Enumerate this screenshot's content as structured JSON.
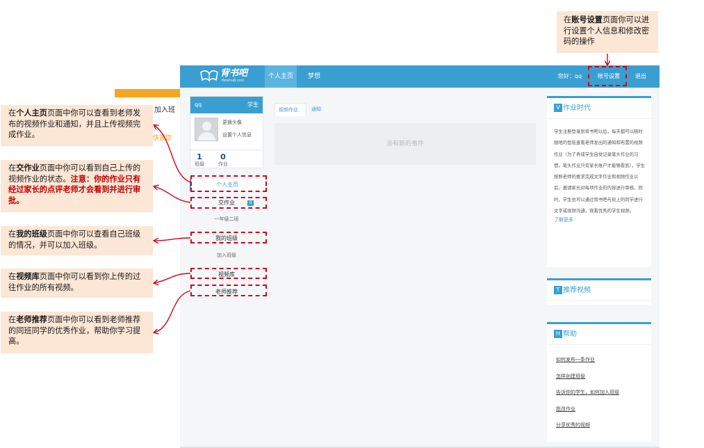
{
  "app": {
    "logo": {
      "name": "背书吧",
      "domain": "Beishu8.com"
    },
    "nav": {
      "home": "个人主页",
      "dream": "梦想",
      "hello": "您好：qq",
      "settings": "帐号设置",
      "logout": "退出"
    },
    "profile": {
      "username": "qq",
      "role": "学生",
      "change_avatar": "更换头像",
      "set_info": "设置个人信息",
      "stats": [
        {
          "num": "1",
          "label": "班级"
        },
        {
          "num": "0",
          "label": "作业"
        }
      ]
    },
    "menu": {
      "home": "个人主页",
      "homework": "交作业",
      "homework_badge": "0",
      "class_name": "一年级二班",
      "my_class": "我的班级",
      "join_class": "加入班级",
      "video_lib": "视频库",
      "teacher_rec": "老师推荐"
    },
    "tabs": [
      "视频作业",
      "通知"
    ],
    "events_empty": "没有新的事件",
    "panels": {
      "era": {
        "badge": "V",
        "title": "作业时代",
        "text": "学生注册登录到背书吧以后，每天都可以随时随地的登陆查看老师发出的通知和布置的视频作业（为了养成学生自觉记录笔头作业的习惯，笔头作业只有家长账户才能够看到），学生按照老师的要求完成文字作业和视频作业以后，邀请家长对每项作业的内容进行审核。同时，学生也可以通过背书吧与班上的同学进行文字或视频沟通，观看优秀的学生视频。",
        "more": "了解更多"
      },
      "recommend": {
        "badge": "T",
        "title": "推荐视频"
      },
      "help": {
        "badge": "H",
        "title": "帮助",
        "links": [
          "如何发布一条作业",
          "怎样创建班级",
          "告诉你的学生，如何加入班级",
          "批改作业",
          "分享优秀的视频"
        ]
      }
    }
  },
  "fragments": {
    "join": "加入班",
    "orange": "快罢您"
  },
  "callouts": {
    "top": {
      "pre": "在",
      "bold": "账号设置",
      "post": "页面你可以进行设置个人信息和修改密码的操作"
    },
    "home": {
      "pre": "在",
      "bold": "个人主页",
      "post": "页面中你可以查看到老师发布的视频作业和通知，并且上传视频完成作业。"
    },
    "homework": {
      "pre": "在",
      "bold": "交作业",
      "post": "页面中你可以看到自己上传的视频作业的状态。",
      "warn": "注意：你的作业只有经过家长的点评老师才会看到并进行审批。"
    },
    "class": {
      "pre": "在",
      "bold": "我的班级",
      "post": "页面中你可以查看自己班级的情况，并可以加入班级。"
    },
    "library": {
      "pre": "在",
      "bold": "视频库",
      "post": "页面中你可以看到你上传的过往作业的所有视频。"
    },
    "teacher": {
      "pre": "在",
      "bold": "老师推荐",
      "post": "页面中你可以看到老师推荐的同班同学的优秀作业，帮助你学习提高。"
    }
  },
  "colors": {
    "brand": "#3a9fd0",
    "callout_bg": "#fce6d6",
    "highlight": "#d0021b",
    "accent": "#f5a623"
  }
}
